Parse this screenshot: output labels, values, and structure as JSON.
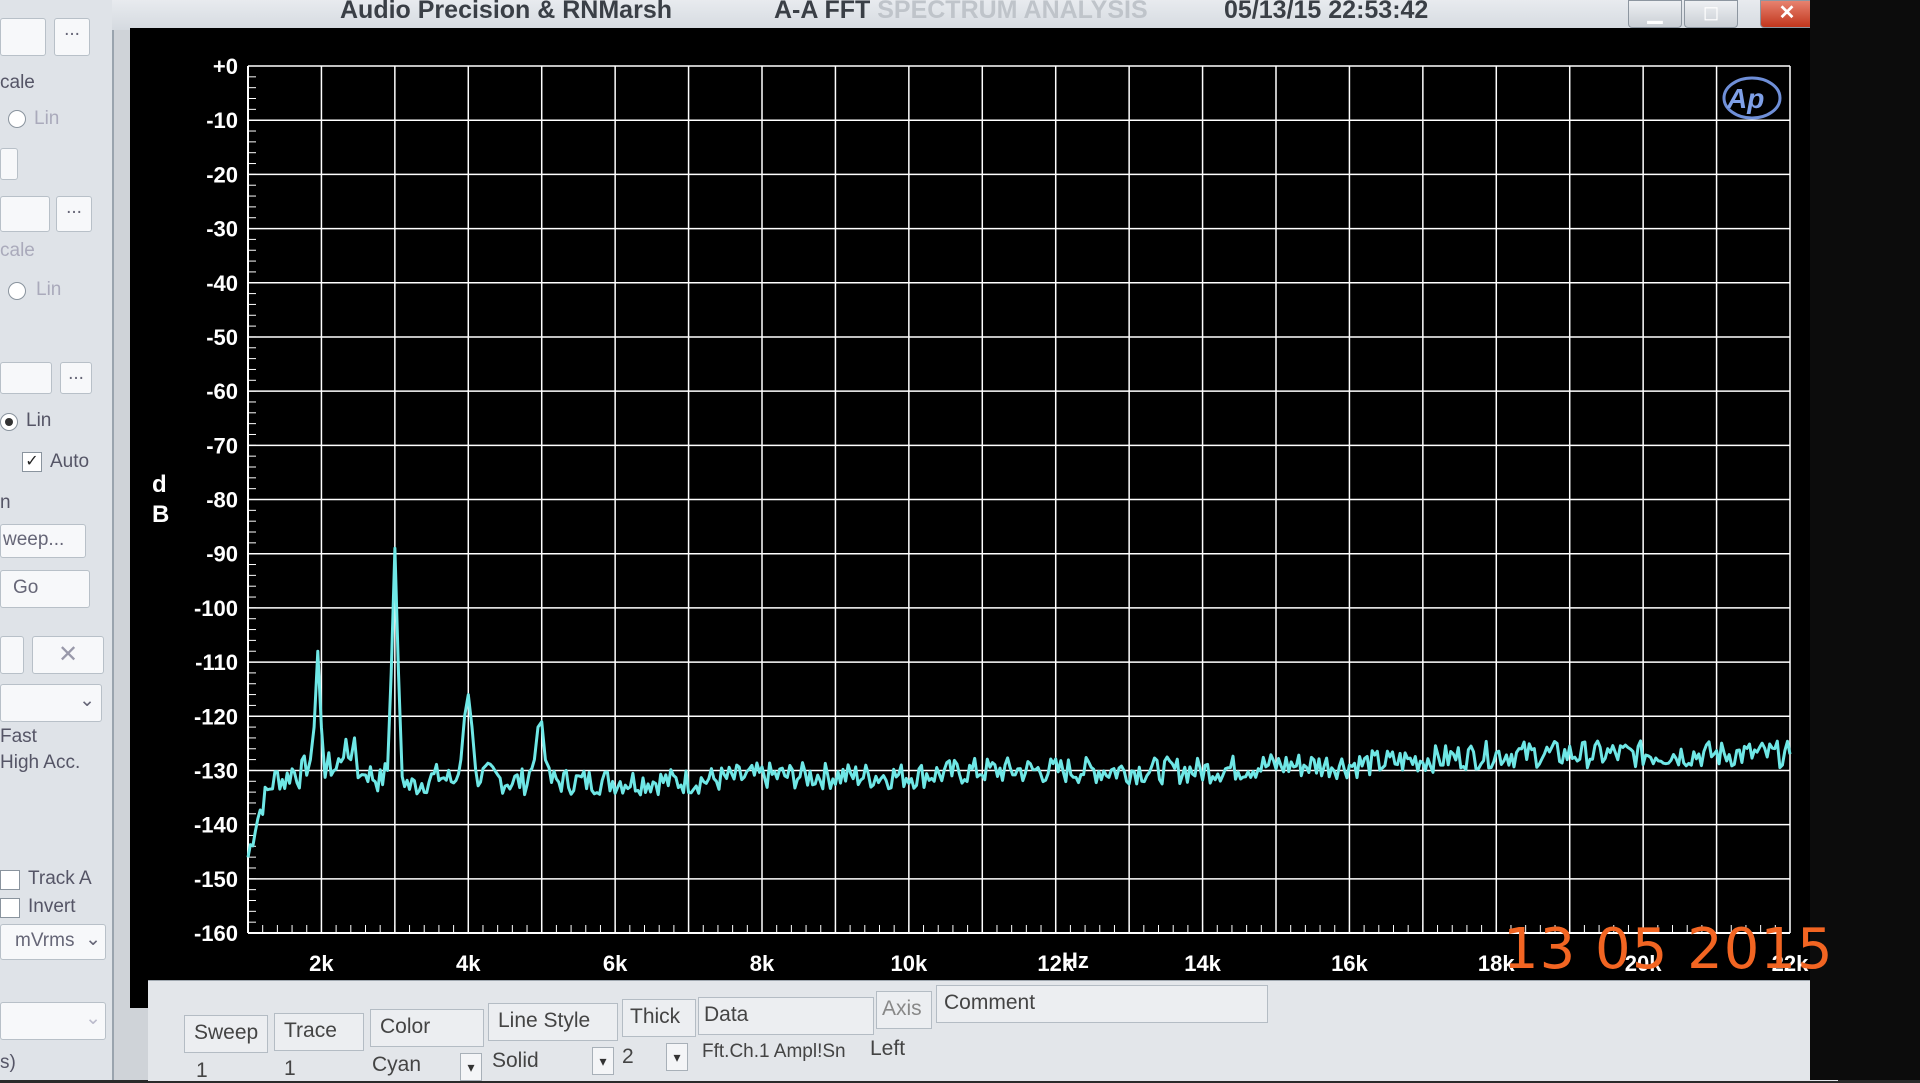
{
  "window": {
    "title_left": "Audio Precision & RNMarsh",
    "title_mid": "A-A FFT ",
    "title_faded": "SPECTRUM ANALYSIS",
    "title_time": "05/13/15 22:53:42",
    "minimize_label": "▁",
    "maximize_label": "◻",
    "close_label": "✕"
  },
  "left_panel": {
    "scale1": "cale",
    "lin1": "Lin",
    "scale2": "cale",
    "lin2": "Lin",
    "lin3": "Lin",
    "auto": "Auto",
    "n": "n",
    "sweep": "weep...",
    "go": "Go",
    "fast": "Fast",
    "high_acc": "High Acc.",
    "track_a": "Track A",
    "invert": "Invert",
    "units": "mVrms",
    "s": "s)",
    "dots": "...",
    "x": "✕",
    "check": "✓",
    "chev": "⌄"
  },
  "logo": "Ap",
  "chart_data": {
    "type": "line",
    "ylabel": "dB",
    "xlabel": "Hz",
    "ylim": [
      -160,
      0
    ],
    "xlim": [
      1000,
      22000
    ],
    "y_ticks": [
      "+0",
      "-10",
      "-20",
      "-30",
      "-40",
      "-50",
      "-60",
      "-70",
      "-80",
      "-90",
      "-100",
      "-110",
      "-120",
      "-130",
      "-140",
      "-150",
      "-160"
    ],
    "x_ticks": [
      "2k",
      "4k",
      "6k",
      "8k",
      "10k",
      "12k",
      "14k",
      "16k",
      "18k",
      "20k",
      "22k"
    ],
    "grid": true,
    "series": [
      {
        "color": "#6fe7e6",
        "x": [
          1000,
          1100,
          1200,
          1300,
          1400,
          1500,
          1600,
          1700,
          1800,
          1850,
          1900,
          1950,
          2000,
          2050,
          2100,
          2200,
          2300,
          2400,
          2450,
          2500,
          2550,
          2600,
          2700,
          2800,
          2900,
          2950,
          3000,
          3050,
          3100,
          3200,
          3400,
          3600,
          3800,
          3900,
          3950,
          4000,
          4050,
          4100,
          4300,
          4500,
          4800,
          4900,
          4950,
          5000,
          5050,
          5100,
          5400,
          6000,
          7000,
          8000,
          9000,
          10000,
          11000,
          12000,
          13000,
          14000,
          15000,
          16000,
          17000,
          18000,
          19000,
          20000,
          21000,
          22000
        ],
        "y": [
          -146,
          -140,
          -136,
          -133,
          -131,
          -132,
          -130,
          -131,
          -129,
          -128,
          -122,
          -108,
          -122,
          -131,
          -129,
          -130,
          -126,
          -128,
          -124,
          -130,
          -131,
          -130,
          -131,
          -132,
          -130,
          -112,
          -89,
          -112,
          -131,
          -133,
          -132,
          -131,
          -132,
          -128,
          -120,
          -116,
          -122,
          -131,
          -131,
          -132,
          -132,
          -128,
          -122,
          -121,
          -126,
          -132,
          -132,
          -132,
          -132,
          -131,
          -131,
          -131,
          -130,
          -130,
          -130,
          -130,
          -129,
          -129,
          -128,
          -127,
          -127,
          -127,
          -127,
          -127
        ]
      }
    ]
  },
  "trace_table": {
    "headers": [
      "Sweep",
      "Trace",
      "Color",
      "Line Style",
      "Thick",
      "Data",
      "Axis",
      "Comment"
    ],
    "row": {
      "sweep": "1",
      "trace": "1",
      "color": "Cyan",
      "line_style": "Solid",
      "thick": "2",
      "data": "Fft.Ch.1 Ampl!Sn",
      "axis": "Left"
    },
    "arrow": "▾"
  },
  "date_stamp": "13 05 2015"
}
